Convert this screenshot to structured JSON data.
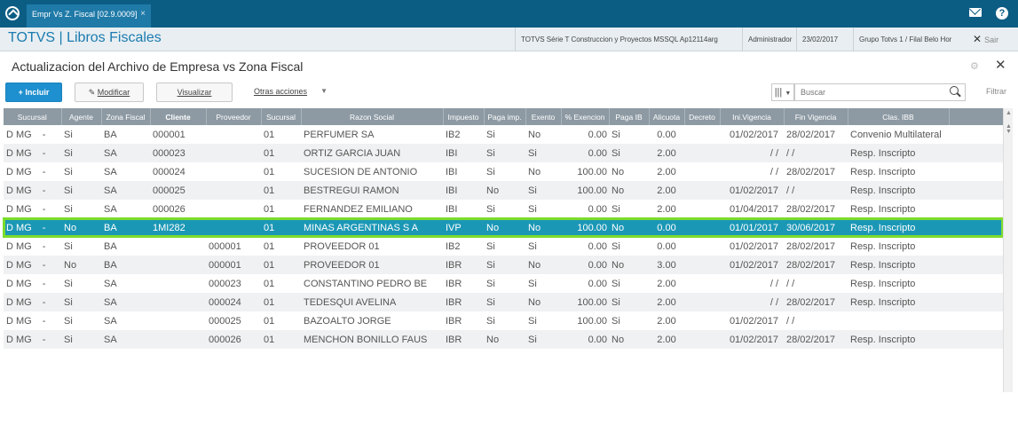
{
  "window": {
    "tab_title": "Empr Vs Z. Fiscal [02.9.0009]",
    "tab_close": "×"
  },
  "header": {
    "brand": "TOTVS | Libros Fiscales",
    "environment": "TOTVS Série T Construccion y Proyectos MSSQL Ap12114arg",
    "user": "Administrador",
    "date": "23/02/2017",
    "company": "Grupo Totvs 1 / Filal Belo Hor",
    "exit_label": "Sair"
  },
  "page": {
    "title": "Actualizacion del Archivo de Empresa vs Zona Fiscal"
  },
  "toolbar": {
    "incluir": "+ Incluir",
    "modificar": "Modificar",
    "visualizar": "Visualizar",
    "otras": "Otras acciones",
    "search_placeholder": "Buscar",
    "filter": "Filtrar"
  },
  "grid": {
    "columns": [
      "Sucursal",
      "Agente",
      "Zona Fiscal",
      "Cliente",
      "Proveedor",
      "Sucursal",
      "Razon Social",
      "Impuesto",
      "Paga imp.",
      "Exento",
      "% Exencion",
      "Paga IB",
      "Alicuota",
      "Decreto",
      "Ini.Vigencia",
      "Fin Vigencia",
      "Clas. IBB"
    ],
    "rows": [
      {
        "suc": "D MG",
        "dash": "-",
        "agente": "Si",
        "zona": "BA",
        "cliente": "000001",
        "prov": "",
        "suc2": "01",
        "razon": "PERFUMER SA",
        "imp": "IB2",
        "paga": "Si",
        "exento": "No",
        "exencion": "0.00",
        "pagaib": "Si",
        "alic": "0.00",
        "decreto": "",
        "ini": "01/02/2017",
        "fin": "28/02/2017",
        "clas": "Convenio Multilateral"
      },
      {
        "suc": "D MG",
        "dash": "-",
        "agente": "Si",
        "zona": "SA",
        "cliente": "000023",
        "prov": "",
        "suc2": "01",
        "razon": "ORTIZ GARCIA JUAN",
        "imp": "IBI",
        "paga": "Si",
        "exento": "Si",
        "exencion": "0.00",
        "pagaib": "Si",
        "alic": "2.00",
        "decreto": "",
        "ini": "/ /",
        "fin": "/ /",
        "clas": "Resp. Inscripto"
      },
      {
        "suc": "D MG",
        "dash": "-",
        "agente": "Si",
        "zona": "SA",
        "cliente": "000024",
        "prov": "",
        "suc2": "01",
        "razon": "SUCESION DE ANTONIO",
        "imp": "IBI",
        "paga": "Si",
        "exento": "No",
        "exencion": "100.00",
        "pagaib": "No",
        "alic": "2.00",
        "decreto": "",
        "ini": "/ /",
        "fin": "28/02/2017",
        "clas": "Resp. Inscripto"
      },
      {
        "suc": "D MG",
        "dash": "-",
        "agente": "Si",
        "zona": "SA",
        "cliente": "000025",
        "prov": "",
        "suc2": "01",
        "razon": "BESTREGUI RAMON",
        "imp": "IBI",
        "paga": "No",
        "exento": "Si",
        "exencion": "100.00",
        "pagaib": "No",
        "alic": "2.00",
        "decreto": "",
        "ini": "01/02/2017",
        "fin": "/ /",
        "clas": "Resp. Inscripto"
      },
      {
        "suc": "D MG",
        "dash": "-",
        "agente": "Si",
        "zona": "SA",
        "cliente": "000026",
        "prov": "",
        "suc2": "01",
        "razon": "FERNANDEZ EMILIANO",
        "imp": "IBI",
        "paga": "Si",
        "exento": "Si",
        "exencion": "0.00",
        "pagaib": "Si",
        "alic": "2.00",
        "decreto": "",
        "ini": "01/04/2017",
        "fin": "28/02/2017",
        "clas": "Resp. Inscripto"
      },
      {
        "suc": "D MG",
        "dash": "-",
        "agente": "No",
        "zona": "BA",
        "cliente": "1MI282",
        "prov": "",
        "suc2": "01",
        "razon": "MINAS ARGENTINAS S A",
        "imp": "IVP",
        "paga": "No",
        "exento": "No",
        "exencion": "100.00",
        "pagaib": "No",
        "alic": "0.00",
        "decreto": "",
        "ini": "01/01/2017",
        "fin": "30/06/2017",
        "clas": "Resp. Inscripto"
      },
      {
        "suc": "D MG",
        "dash": "-",
        "agente": "Si",
        "zona": "BA",
        "cliente": "",
        "prov": "000001",
        "suc2": "01",
        "razon": "PROVEEDOR 01",
        "imp": "IB2",
        "paga": "Si",
        "exento": "Si",
        "exencion": "0.00",
        "pagaib": "Si",
        "alic": "0.00",
        "decreto": "",
        "ini": "01/02/2017",
        "fin": "28/02/2017",
        "clas": "Resp. Inscripto"
      },
      {
        "suc": "D MG",
        "dash": "-",
        "agente": "No",
        "zona": "BA",
        "cliente": "",
        "prov": "000001",
        "suc2": "01",
        "razon": "PROVEEDOR 01",
        "imp": "IBR",
        "paga": "Si",
        "exento": "No",
        "exencion": "0.00",
        "pagaib": "No",
        "alic": "3.00",
        "decreto": "",
        "ini": "01/02/2017",
        "fin": "28/02/2017",
        "clas": "Resp. Inscripto"
      },
      {
        "suc": "D MG",
        "dash": "-",
        "agente": "Si",
        "zona": "SA",
        "cliente": "",
        "prov": "000023",
        "suc2": "01",
        "razon": "CONSTANTINO PEDRO BE",
        "imp": "IBR",
        "paga": "Si",
        "exento": "Si",
        "exencion": "0.00",
        "pagaib": "Si",
        "alic": "2.00",
        "decreto": "",
        "ini": "/ /",
        "fin": "/ /",
        "clas": "Resp. Inscripto"
      },
      {
        "suc": "D MG",
        "dash": "-",
        "agente": "Si",
        "zona": "SA",
        "cliente": "",
        "prov": "000024",
        "suc2": "01",
        "razon": "TEDESQUI AVELINA",
        "imp": "IBR",
        "paga": "Si",
        "exento": "No",
        "exencion": "100.00",
        "pagaib": "Si",
        "alic": "2.00",
        "decreto": "",
        "ini": "/ /",
        "fin": "28/02/2017",
        "clas": "Resp. Inscripto"
      },
      {
        "suc": "D MG",
        "dash": "-",
        "agente": "Si",
        "zona": "SA",
        "cliente": "",
        "prov": "000025",
        "suc2": "01",
        "razon": "BAZOALTO JORGE",
        "imp": "IBR",
        "paga": "Si",
        "exento": "Si",
        "exencion": "100.00",
        "pagaib": "Si",
        "alic": "2.00",
        "decreto": "",
        "ini": "01/02/2017",
        "fin": "/ /",
        "clas": ""
      },
      {
        "suc": "D MG",
        "dash": "-",
        "agente": "Si",
        "zona": "SA",
        "cliente": "",
        "prov": "000026",
        "suc2": "01",
        "razon": "MENCHON BONILLO FAUS",
        "imp": "IBR",
        "paga": "No",
        "exento": "Si",
        "exencion": "0.00",
        "pagaib": "No",
        "alic": "2.00",
        "decreto": "",
        "ini": "01/02/2017",
        "fin": "28/02/2017",
        "clas": "Resp. Inscripto"
      }
    ],
    "selected_index": 5
  },
  "colors": {
    "window_bar": "#0c5d84",
    "brand": "#1b7bb0",
    "header_row": "#8d9aa3",
    "selected_row": "#1b97b6",
    "selected_outline": "#7cdc2c",
    "primary_button": "#1e8fcf"
  },
  "icons": [
    "totvs-logo-icon",
    "close-tab-icon",
    "mail-icon",
    "help-icon",
    "exit-icon",
    "gear-icon",
    "close-icon",
    "pencil-icon",
    "columns-icon",
    "search-icon"
  ]
}
